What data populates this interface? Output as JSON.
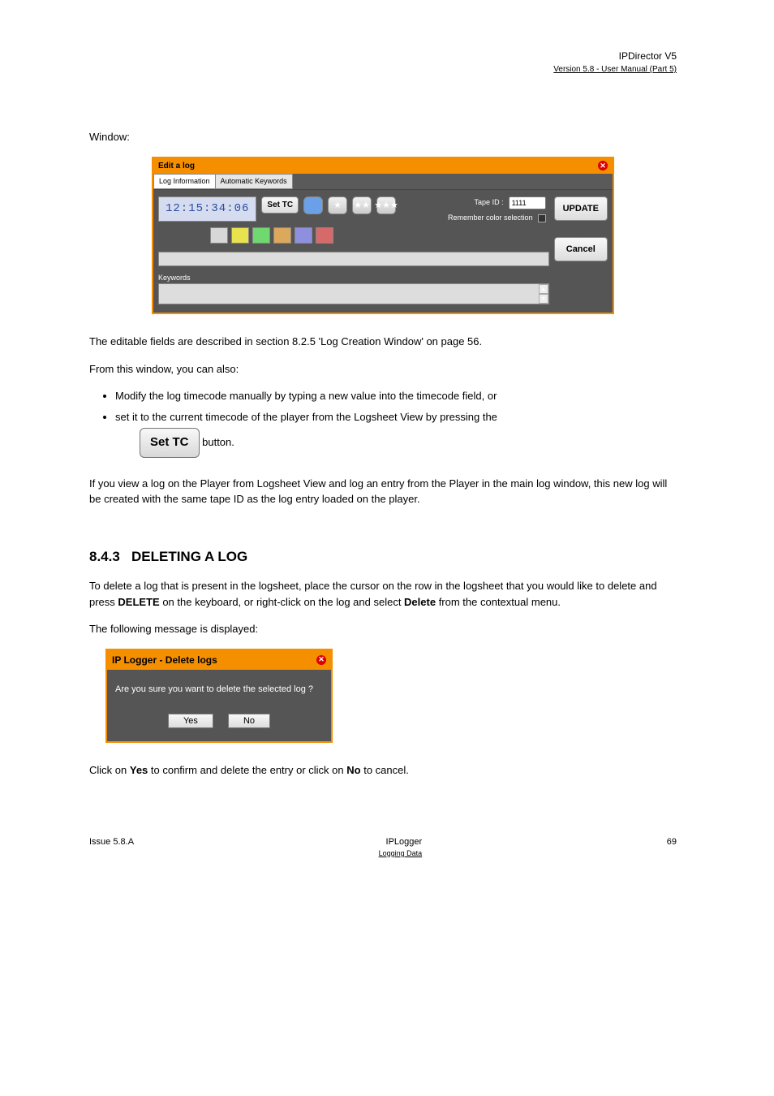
{
  "header": {
    "product": "IPDirector V5",
    "version": "Version 5.8 - User Manual (Part 5)"
  },
  "para_intro": "Window:",
  "edit_window": {
    "title": "Edit a log",
    "tabs": {
      "active": "Log Information",
      "other": "Automatic Keywords"
    },
    "timecode": "12:15:34:06",
    "set_tc": "Set TC",
    "tape_label": "Tape ID :",
    "tape_value": "1111",
    "remember": "Remember color selection",
    "keywords_label": "Keywords",
    "update": "UPDATE",
    "cancel": "Cancel",
    "colors": {
      "row2": [
        "#d7d7d7",
        "#e7e24d",
        "#6fd86f",
        "#dca85c",
        "#8f8fe0",
        "#d66a6a"
      ]
    }
  },
  "para2_seg1": "The editable fields are described in section ",
  "para2_link": "8.2.5",
  "para2_seg2": " 'Log Creation Window' on page ",
  "para2_page": "56",
  "para2_seg3": ".",
  "para3": "From this window, you can also:",
  "bullets": [
    "Modify the log timecode manually by typing a new value into the timecode field, or",
    "set it to the current timecode of the player from the Logsheet View by pressing the "
  ],
  "bullet2_suffix": " button.",
  "settc_btn": "Set TC",
  "para4": "If you view a log on the Player from Logsheet View and log an entry from the Player in the main log window, this new log will be created with the same tape ID as the log entry loaded on the player.",
  "delete_heading_num": "8.4.3",
  "delete_heading_title": "DELETING A LOG",
  "para5_seg1": "To delete a log that is present in the logsheet, place the cursor on the row in the logsheet that you would like to delete and press ",
  "para5_key": "DELETE",
  "para5_seg2": " on the keyboard, or right-click on the log and select ",
  "para5_menu": "Delete",
  "para5_seg3": " from the contextual menu.",
  "para6": "The following message is displayed:",
  "delete_dialog": {
    "title": "IP Logger - Delete logs",
    "message": "Are you sure you want to delete the selected log ?",
    "yes": "Yes",
    "no": "No"
  },
  "para7_seg1": "Click on ",
  "para7_yes": "Yes",
  "para7_seg2": " to confirm and delete the entry or click on ",
  "para7_no": "No",
  "para7_seg3": " to cancel.",
  "footer": {
    "left": "Issue 5.8.A",
    "right1": "IPLogger",
    "right2": "Logging Data",
    "page": "69"
  }
}
